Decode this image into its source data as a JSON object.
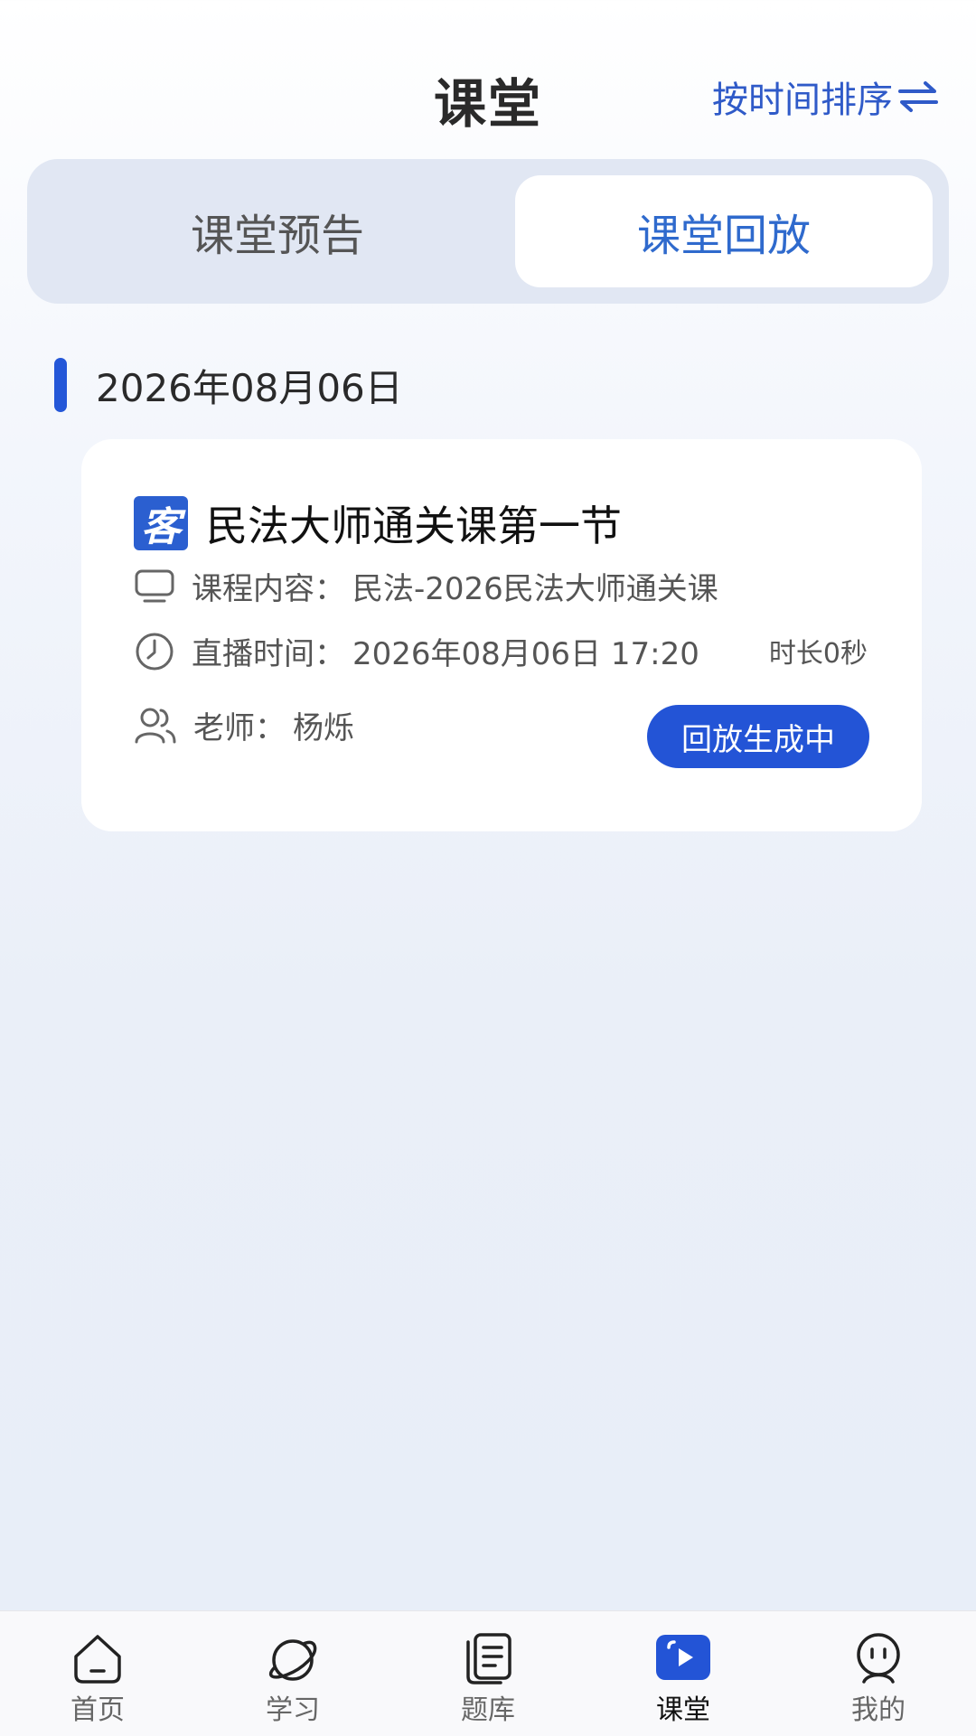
{
  "header": {
    "title": "课堂",
    "sort_label": "按时间排序"
  },
  "tabs": [
    {
      "label": "课堂预告",
      "active": false
    },
    {
      "label": "课堂回放",
      "active": true
    }
  ],
  "date_group": {
    "date": "2026年08月06日"
  },
  "course": {
    "badge_char": "客",
    "title": "民法大师通关课第一节",
    "content_label": "课程内容：",
    "content_value": "民法-2026民法大师通关课",
    "time_label": "直播时间：",
    "time_value": "2026年08月06日 17:20",
    "duration": "时长0秒",
    "teacher_label": "老师：",
    "teacher_value": "杨烁",
    "status_button": "回放生成中"
  },
  "bottom_nav": [
    {
      "label": "首页",
      "icon": "home-icon"
    },
    {
      "label": "学习",
      "icon": "planet-icon"
    },
    {
      "label": "题库",
      "icon": "document-icon"
    },
    {
      "label": "课堂",
      "icon": "video-play-icon",
      "active": true
    },
    {
      "label": "我的",
      "icon": "profile-icon"
    }
  ],
  "colors": {
    "accent": "#2354d6",
    "tab_active_text": "#2f6acd",
    "tabs_bg": "#e1e7f3"
  }
}
